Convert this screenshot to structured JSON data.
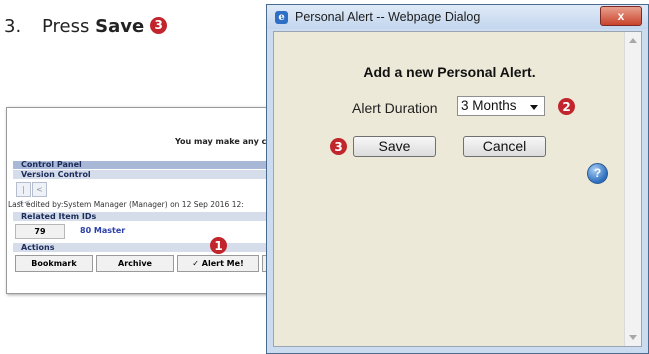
{
  "instruction": {
    "number": "3.",
    "prefix": "Press",
    "bold": "Save",
    "badge": "3"
  },
  "background_panel": {
    "notice": "You may make any c",
    "control_panel": "Control Panel",
    "version_control": "Version Control",
    "nav_first": "|<<",
    "nav_prev": "<",
    "t_letter": "T",
    "last_edited": "Last edited by:System Manager (Manager) on 12 Sep 2016 12:",
    "related_ids_title": "Related Item IDs",
    "id_value": "79",
    "master_link": "80 Master",
    "actions_title": "Actions",
    "actions": [
      "Bookmark",
      "Archive",
      "✓ Alert Me!",
      ""
    ],
    "badge": "1"
  },
  "dialog": {
    "title": "Personal Alert -- Webpage Dialog",
    "close_label": "x",
    "heading": "Add a new Personal Alert.",
    "duration_label": "Alert Duration",
    "duration_value": "3 Months",
    "save_label": "Save",
    "cancel_label": "Cancel",
    "help_label": "?",
    "badge_duration": "2",
    "badge_save": "3"
  }
}
